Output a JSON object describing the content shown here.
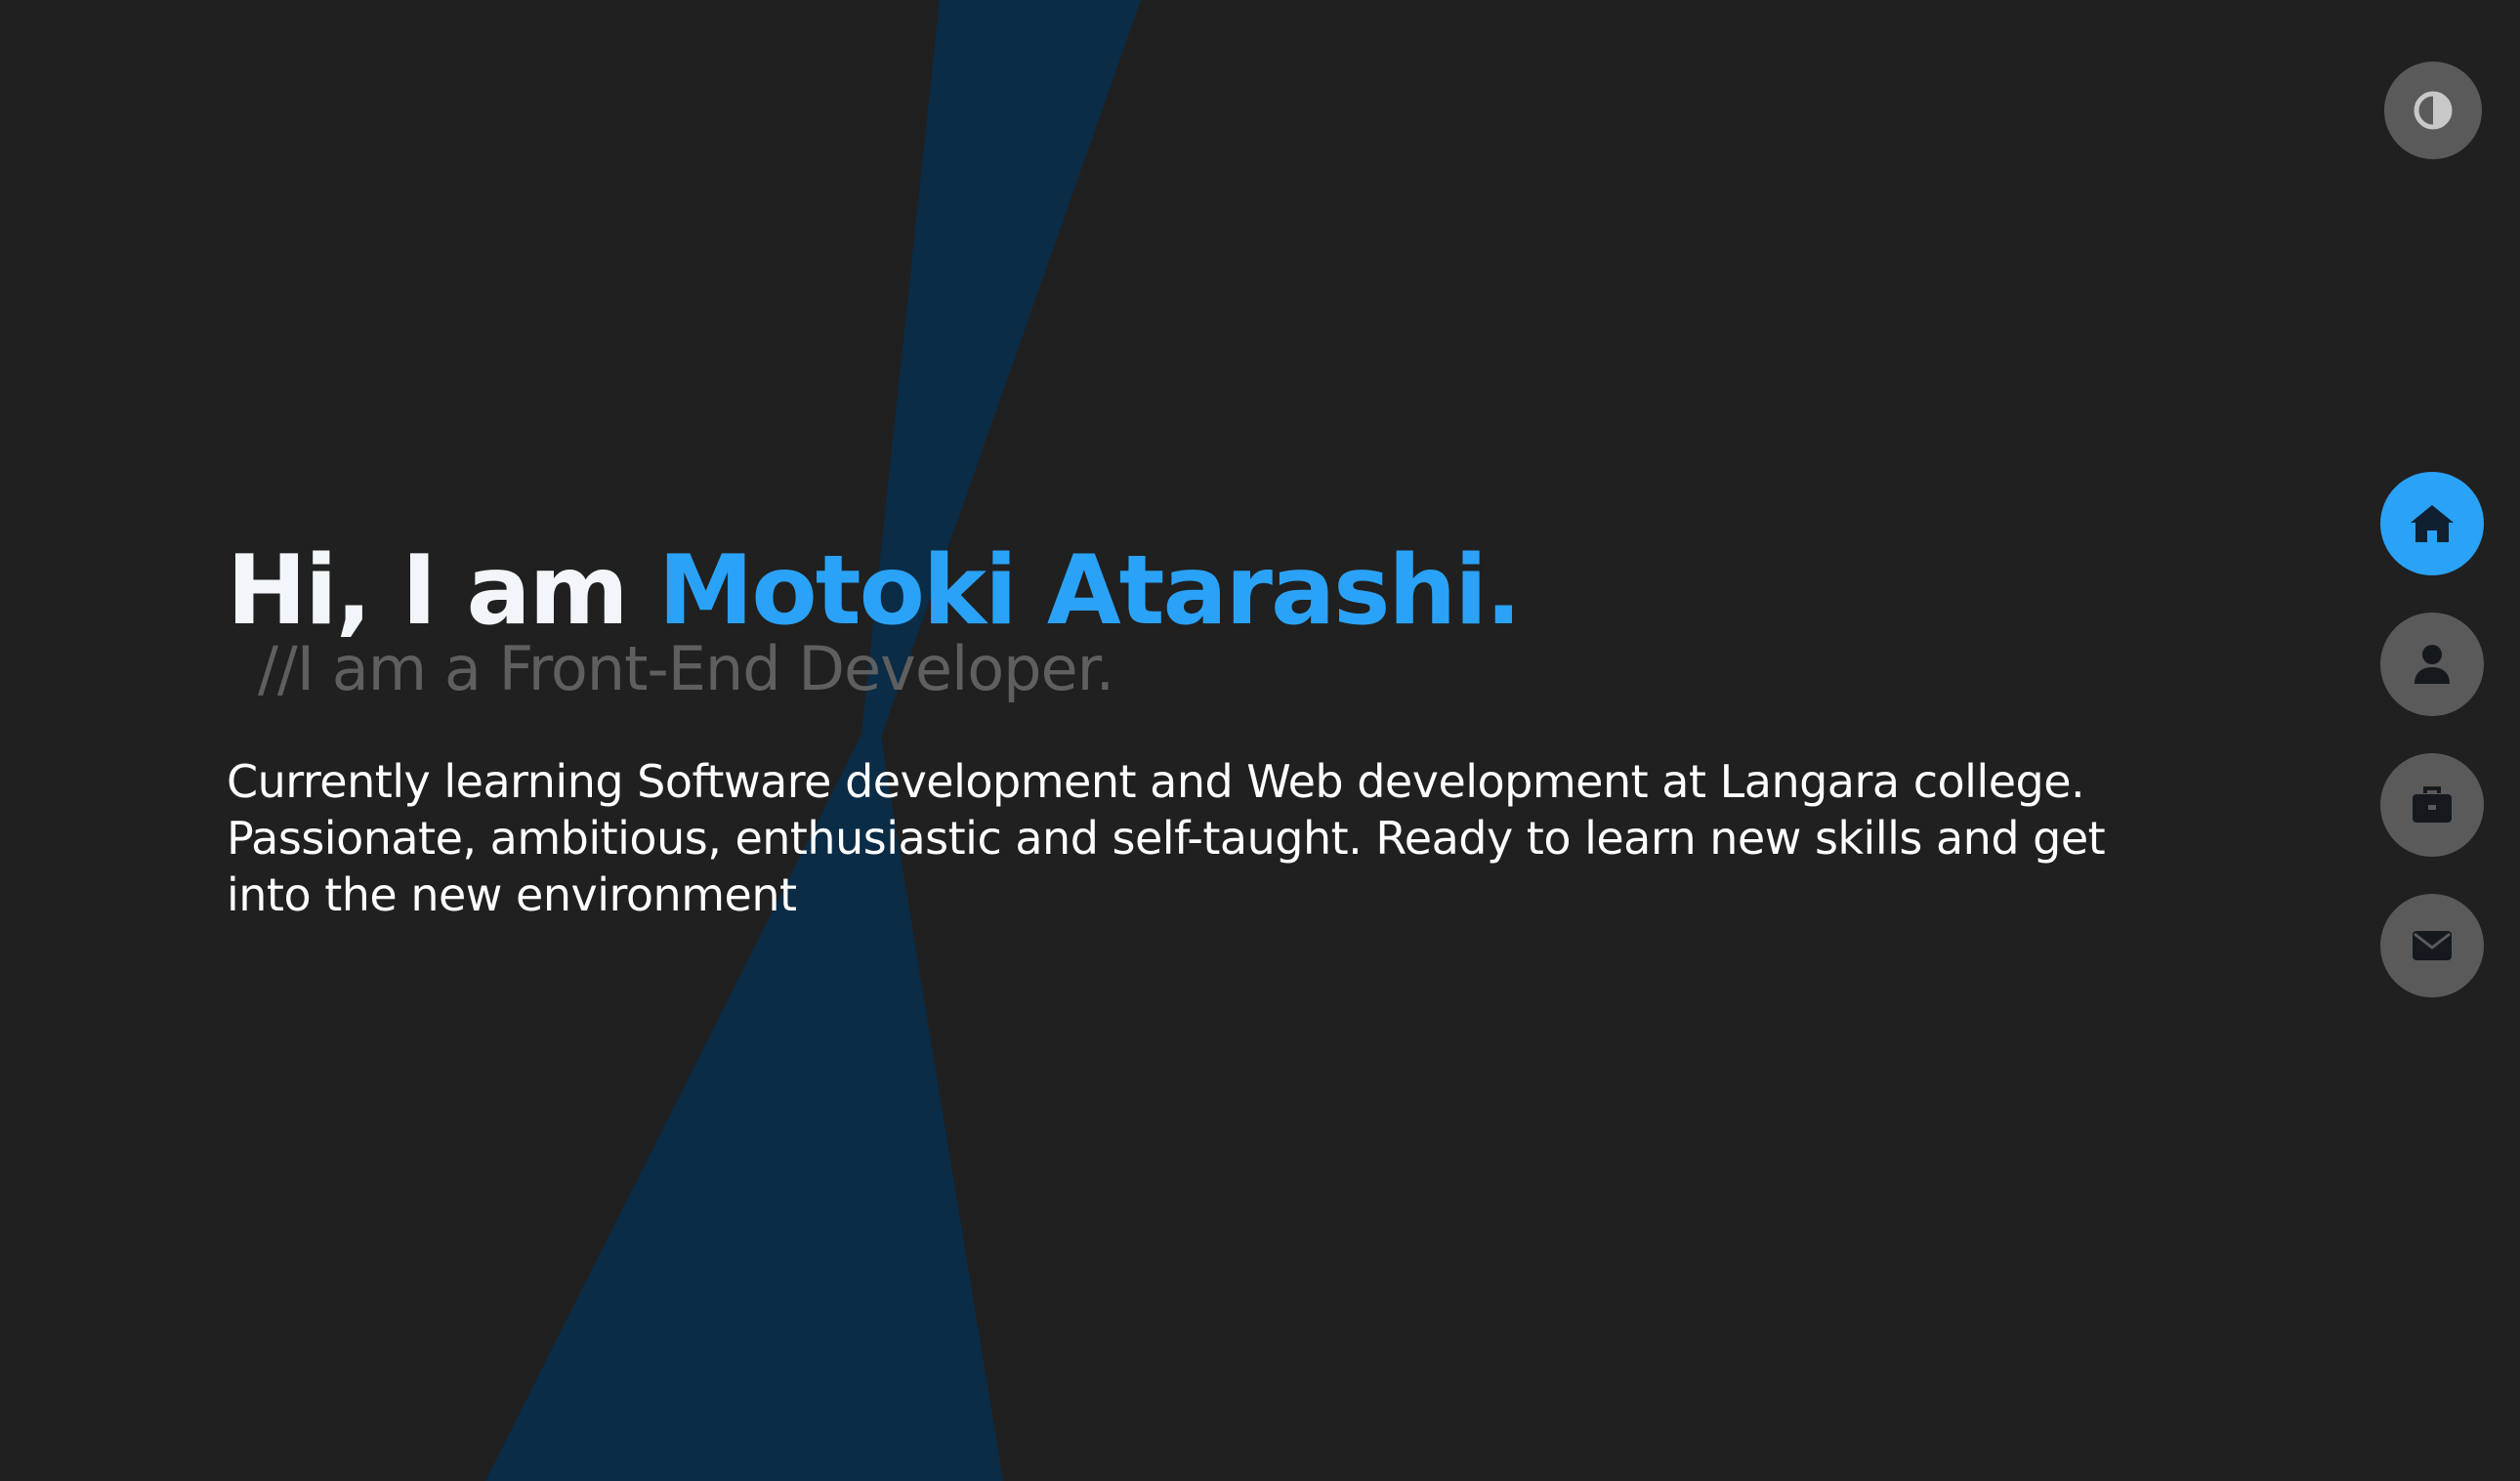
{
  "hero": {
    "greeting": "Hi, I am ",
    "name": "Motoki Atarashi.",
    "subtitle": "//I am a Front-End Developer.",
    "description": "Currently learning Software development and Web development at Langara college. Passionate, ambitious, enthusiastic and self-taught. Ready to learn new skills and get into the new environment"
  },
  "controls": {
    "theme_toggle_icon": "contrast-icon"
  },
  "nav": {
    "items": [
      {
        "icon": "home-icon",
        "active": true
      },
      {
        "icon": "user-icon",
        "active": false
      },
      {
        "icon": "briefcase-icon",
        "active": false
      },
      {
        "icon": "envelope-icon",
        "active": false
      }
    ]
  },
  "colors": {
    "background": "#202020",
    "accent": "#2aa2f7",
    "band": "#0b2c46",
    "muted_text": "#5f5f5f",
    "button": "#5a5a5a"
  }
}
